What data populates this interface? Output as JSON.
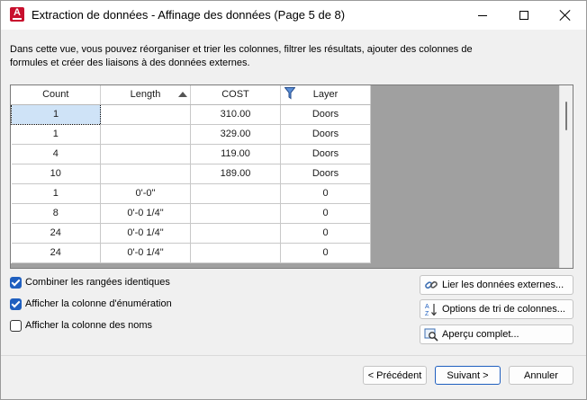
{
  "window": {
    "title": "Extraction de données - Affinage des données (Page 5 de 8)",
    "app_icon_letter": "A"
  },
  "description": "Dans cette vue, vous pouvez réorganiser et trier les colonnes, filtrer les résultats, ajouter des colonnes de formules et créer des liaisons à des données externes.",
  "grid": {
    "columns": [
      "Count",
      "Length",
      "COST",
      "Layer"
    ],
    "sorted_column": "Length",
    "sort_direction": "ascending",
    "filtered_column": "Layer",
    "selected_cell": "Count, row 1",
    "rows": [
      [
        "1",
        "",
        "310.00",
        "Doors"
      ],
      [
        "1",
        "",
        "329.00",
        "Doors"
      ],
      [
        "4",
        "",
        "119.00",
        "Doors"
      ],
      [
        "10",
        "",
        "189.00",
        "Doors"
      ],
      [
        "1",
        "0'-0\"",
        "",
        "0"
      ],
      [
        "8",
        "0'-0 1/4\"",
        "",
        "0"
      ],
      [
        "24",
        "0'-0 1/4\"",
        "",
        "0"
      ],
      [
        "24",
        "0'-0 1/4\"",
        "",
        "0"
      ]
    ]
  },
  "options": [
    {
      "label": "Combiner les rangées identiques",
      "checked": true
    },
    {
      "label": "Afficher la colonne d'énumération",
      "checked": true
    },
    {
      "label": "Afficher la colonne des noms",
      "checked": false
    }
  ],
  "actions": {
    "link_external": "Lier les données externes...",
    "sort_options": "Options de tri de colonnes...",
    "full_preview": "Aperçu complet..."
  },
  "footer": {
    "previous": "< Précédent",
    "next": "Suivant >",
    "cancel": "Annuler"
  },
  "colors": {
    "accent": "#1f5fbf",
    "app_icon": "#c8102e",
    "selection": "#cfe3f7",
    "grid_background": "#a0a0a0"
  },
  "icons": [
    "app-autocad-icon",
    "minimize-icon",
    "maximize-icon",
    "close-icon",
    "sort-ascending-icon",
    "filter-funnel-icon",
    "link-icon",
    "sort-az-icon",
    "preview-magnifier-icon"
  ]
}
